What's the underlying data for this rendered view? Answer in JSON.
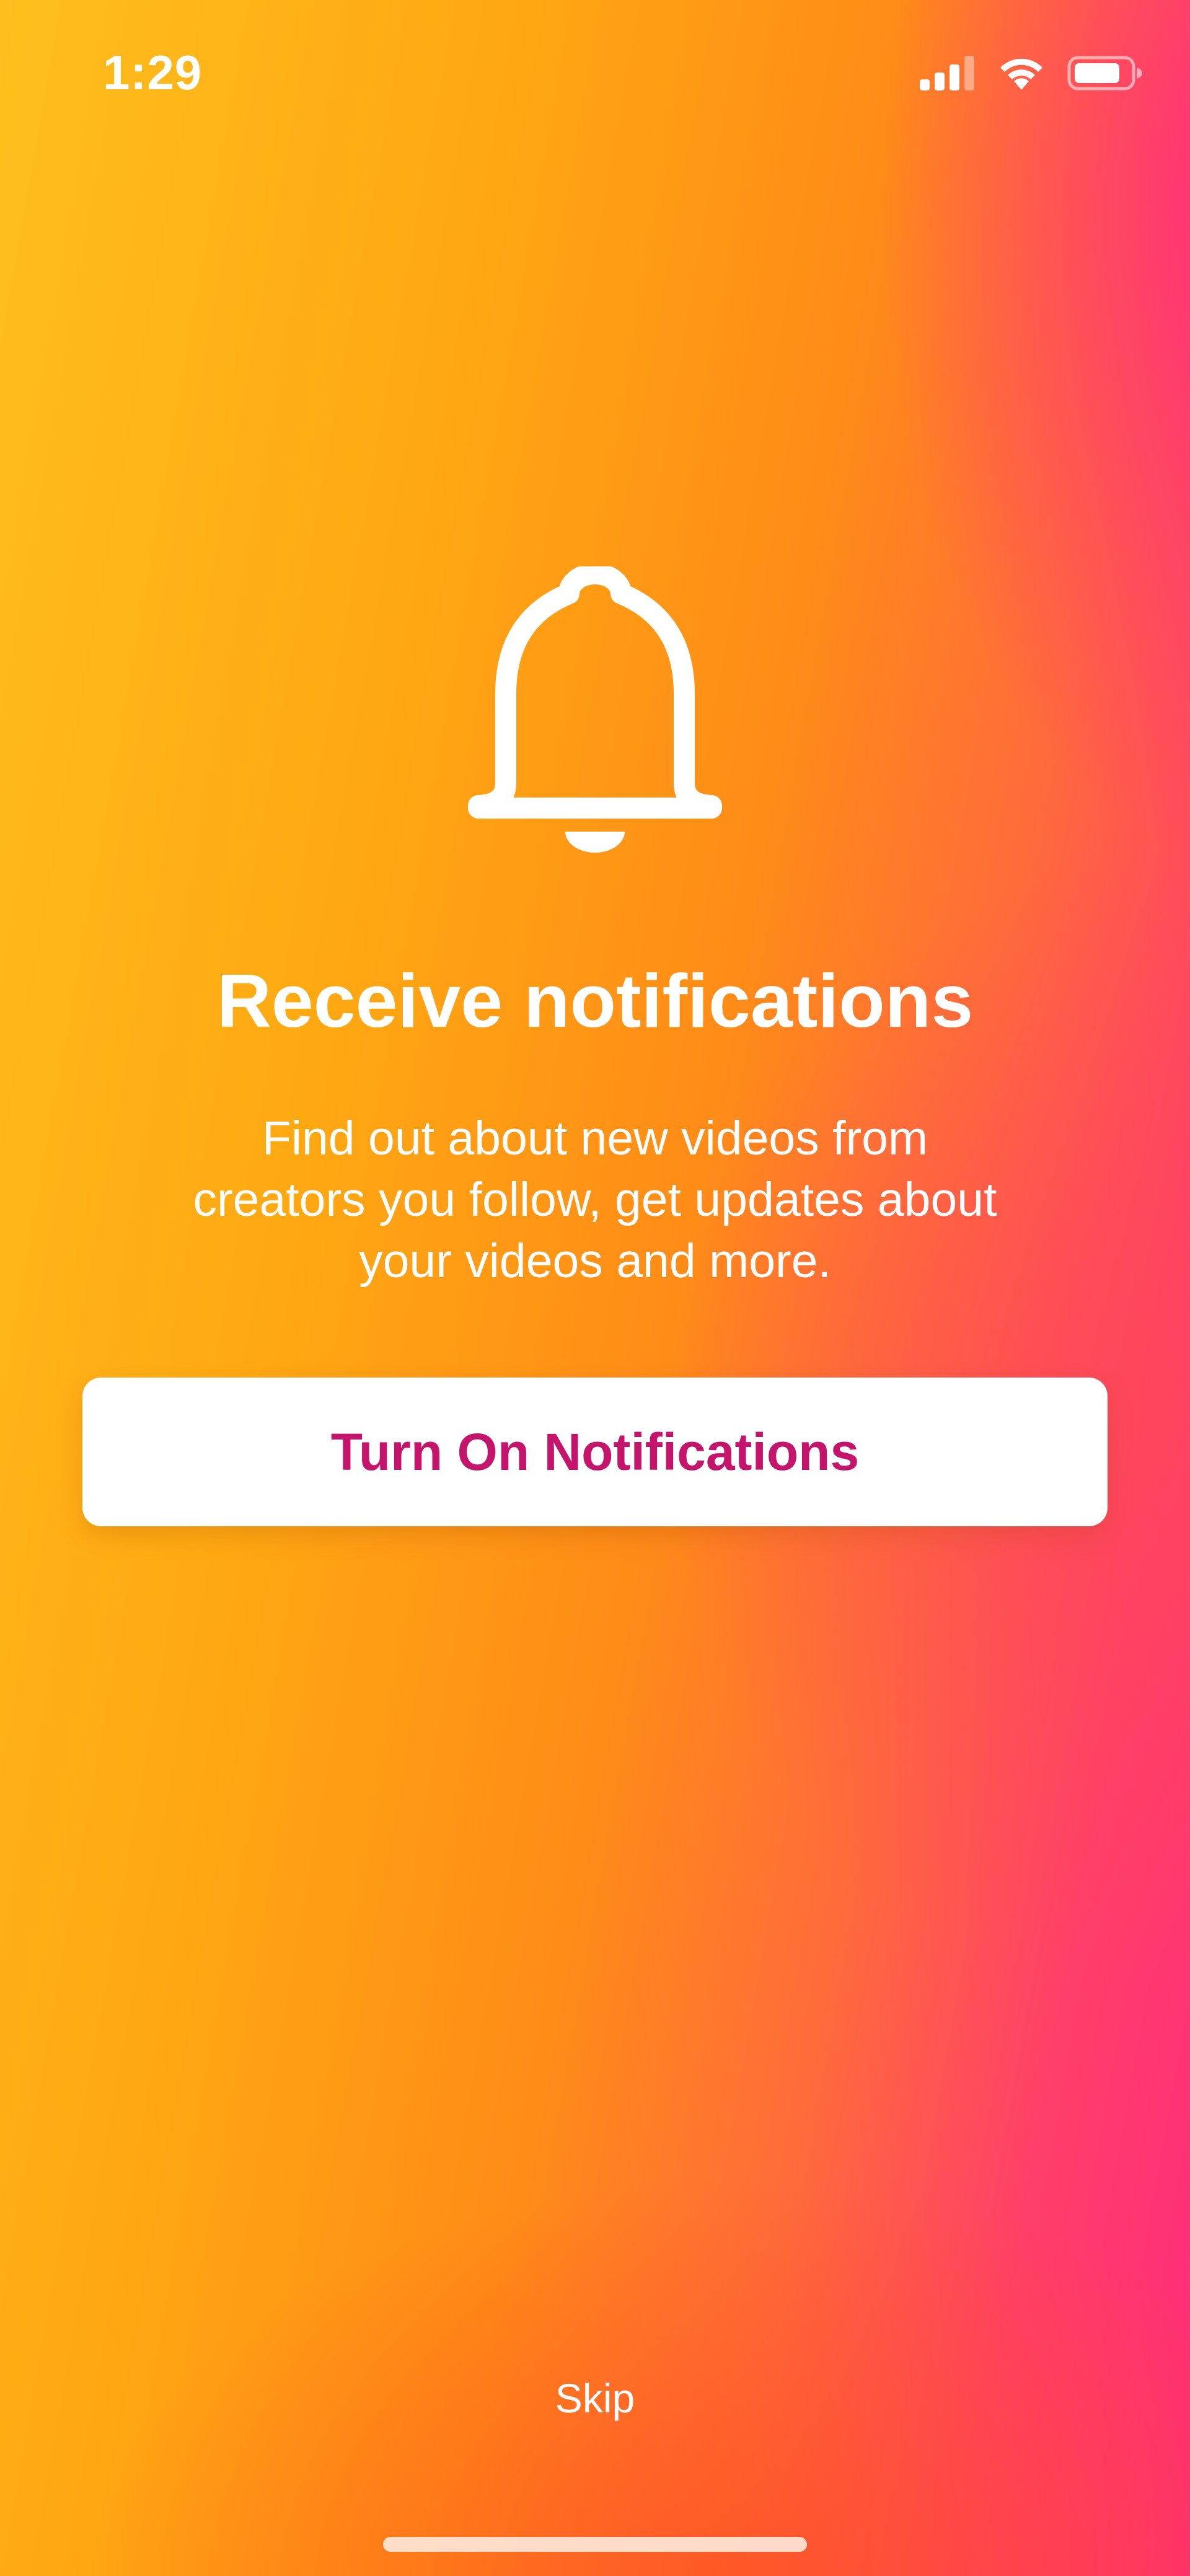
{
  "status_bar": {
    "time": "1:29",
    "icons": [
      "cellular-signal-icon",
      "wifi-icon",
      "battery-icon"
    ]
  },
  "hero": {
    "icon": "bell-icon",
    "title": "Receive notifications",
    "description": "Find out about new videos from\ncreators you follow, get updates about\nyour videos and more."
  },
  "actions": {
    "primary_label": "Turn On Notifications",
    "skip_label": "Skip"
  },
  "colors": {
    "gradient_left": "#ffbe1d",
    "gradient_right": "#ff2a7c",
    "primary_text": "#c4146c",
    "button_background": "#ffffff",
    "text": "#ffffff"
  }
}
